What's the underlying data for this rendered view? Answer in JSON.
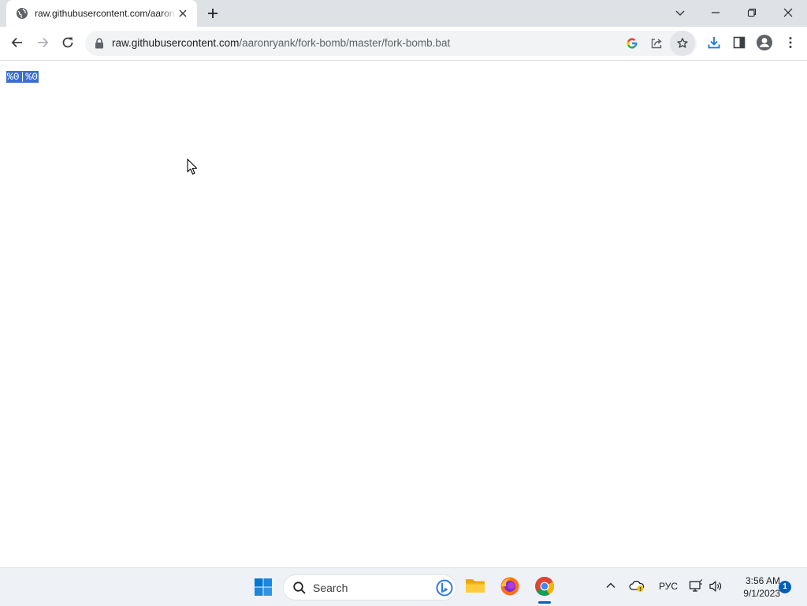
{
  "browser": {
    "tab": {
      "title": "raw.githubusercontent.com/aaronryank/fork-bomb/master/fork-bomb.bat",
      "favicon": "globe-icon"
    },
    "address_bar": {
      "host": "raw.githubusercontent.com",
      "path": "/aaronryank/fork-bomb/master/fork-bomb.bat"
    },
    "toolbar_icons": [
      "back-icon",
      "forward-icon",
      "reload-icon",
      "google-icon",
      "share-icon",
      "star-icon",
      "download-icon",
      "side-panel-icon",
      "profile-icon",
      "menu-icon"
    ]
  },
  "page": {
    "content": "%0|%0",
    "selection_color": "#3b6fd0"
  },
  "taskbar": {
    "search_label": "Search",
    "apps": [
      "file-explorer-icon",
      "firefox-icon",
      "chrome-icon"
    ],
    "language": "РУС",
    "time": "3:56 AM",
    "date": "9/1/2023",
    "notification_count": "1"
  }
}
